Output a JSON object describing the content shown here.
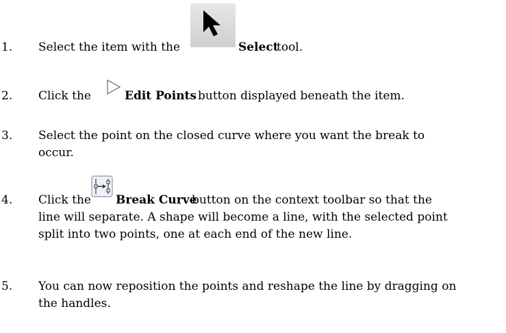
{
  "steps": [
    {
      "number": "1.",
      "before": "Select the item with the",
      "icon": "select-arrow-icon",
      "bold": "Select",
      "after": " tool."
    },
    {
      "number": "2.",
      "before": "Click the",
      "icon": "edit-points-icon",
      "bold": "Edit Points",
      "after": " button displayed beneath the item."
    },
    {
      "number": "3.",
      "line1": "Select the point on the closed curve where you want the break to",
      "line2": "occur."
    },
    {
      "number": "4.",
      "before": "Click the",
      "icon": "break-curve-icon",
      "bold": "Break Curve",
      "after": " button on the context toolbar so that the",
      "line2": "line will separate. A shape will become a line, with the selected point",
      "line3": "split into two points, one at each end of the new line."
    },
    {
      "number": "5.",
      "line1": "You can now reposition the points and reshape the line by dragging on",
      "line2": "the handles."
    }
  ]
}
